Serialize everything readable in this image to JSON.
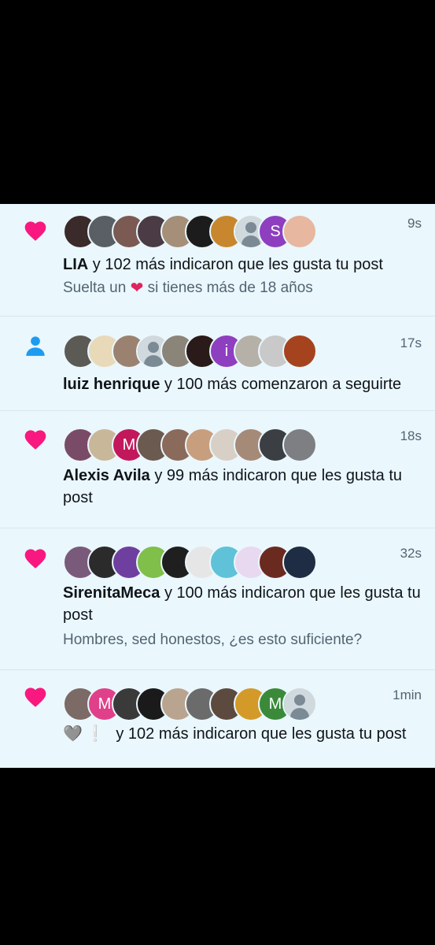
{
  "notifications": [
    {
      "type": "like",
      "type_icon": "heart-icon",
      "time": "9s",
      "actor": "LIA",
      "text": " y 102 más indicaron que les gusta tu post",
      "subtext_before": "Suelta un ",
      "subtext_after": " si tienes más de 18 años",
      "avatars": [
        {
          "color": "#3b2a2a"
        },
        {
          "color": "#5a5f66"
        },
        {
          "color": "#7a5a52"
        },
        {
          "color": "#4a3b44"
        },
        {
          "color": "#a58f78"
        },
        {
          "color": "#1c1c1c"
        },
        {
          "color": "#c8872e"
        },
        {
          "color": "generic"
        },
        {
          "color": "#8e3fbf",
          "letter": "S"
        },
        {
          "color": "#e7b7a0"
        }
      ]
    },
    {
      "type": "follow",
      "type_icon": "person-icon",
      "time": "17s",
      "actor": "luiz henrique",
      "text": " y 100 más comenzaron a seguirte",
      "avatars": [
        {
          "color": "#5c5a55"
        },
        {
          "color": "#e8d9b8"
        },
        {
          "color": "#9b8270"
        },
        {
          "color": "generic"
        },
        {
          "color": "#8b8478"
        },
        {
          "color": "#2a1a1a"
        },
        {
          "color": "#8e3fbf",
          "letter": "i"
        },
        {
          "color": "#b5b0a8"
        },
        {
          "color": "#c9c9c9"
        },
        {
          "color": "#a5431e"
        }
      ]
    },
    {
      "type": "like",
      "type_icon": "heart-icon",
      "time": "18s",
      "actor": "Alexis Avila",
      "text": " y 99 más indicaron que les gusta tu post",
      "avatars": [
        {
          "color": "#7a4b66"
        },
        {
          "color": "#c9b79a"
        },
        {
          "color": "#c2185b",
          "letter": "M"
        },
        {
          "color": "#6a5a50"
        },
        {
          "color": "#8a6a5a"
        },
        {
          "color": "#c79e7e"
        },
        {
          "color": "#d8cfc6"
        },
        {
          "color": "#a58a78"
        },
        {
          "color": "#3b3f44"
        },
        {
          "color": "#7d7f82"
        }
      ]
    },
    {
      "type": "like",
      "type_icon": "heart-icon",
      "time": "32s",
      "actor": "SirenitaMeca",
      "text": " y 100 más indicaron que les gusta tu post",
      "subtext": "Hombres, sed honestos, ¿es esto suficiente?",
      "avatars": [
        {
          "color": "#7a5a7a"
        },
        {
          "color": "#2b2b2b"
        },
        {
          "color": "#6f3fa0"
        },
        {
          "color": "#7fbf4a"
        },
        {
          "color": "#1f1f1f"
        },
        {
          "color": "#e6e6e6"
        },
        {
          "color": "#5fc2d8"
        },
        {
          "color": "#e8d8f0"
        },
        {
          "color": "#6b2a20"
        },
        {
          "color": "#1e2c44"
        }
      ]
    },
    {
      "type": "like",
      "type_icon": "heart-icon",
      "time": "1min",
      "actor": "",
      "text": " y 102 más indicaron que les gusta tu post",
      "avatars": [
        {
          "color": "#7b6a66"
        },
        {
          "color": "#e0408a",
          "letter": "M"
        },
        {
          "color": "#3a3a3a"
        },
        {
          "color": "#1a1a1a"
        },
        {
          "color": "#b9a48f"
        },
        {
          "color": "#6b6b6b"
        },
        {
          "color": "#5d4a3e"
        },
        {
          "color": "#d39a2a"
        },
        {
          "color": "#3a8a3a",
          "letter": "M"
        },
        {
          "color": "generic"
        }
      ]
    }
  ],
  "colors": {
    "like_heart": "#f91880",
    "follow_person": "#1d9bf0",
    "feed_background": "#eaf7fd"
  }
}
